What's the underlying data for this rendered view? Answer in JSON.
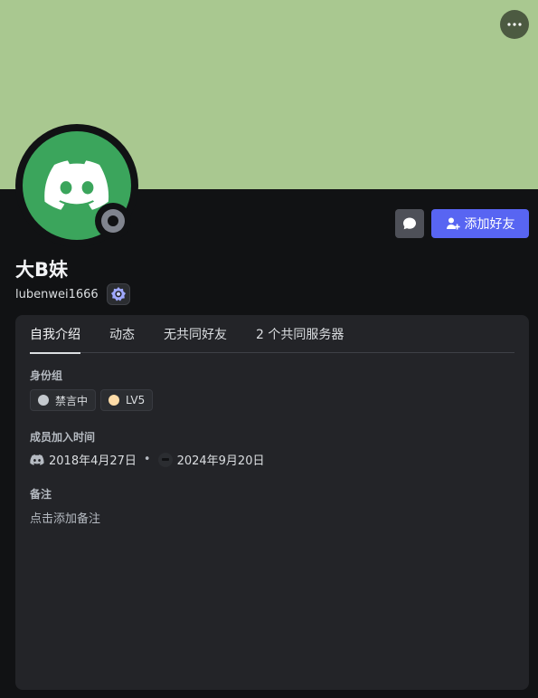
{
  "colors": {
    "banner": "#a9c890",
    "avatar_bg": "#3ba55c",
    "primary": "#5865f2",
    "role_muted": "#c4c9ce",
    "role_lv5": "#ffdca8"
  },
  "header": {
    "more_icon": "ellipsis-icon"
  },
  "profile": {
    "display_name": "大B妹",
    "username": "lubenwei1666",
    "status": "offline",
    "badge_icon": "nitro-badge-icon"
  },
  "actions": {
    "message_icon": "chat-bubble-icon",
    "add_friend_label": "添加好友"
  },
  "tabs": [
    {
      "label": "自我介绍",
      "active": true
    },
    {
      "label": "动态",
      "active": false
    },
    {
      "label": "无共同好友",
      "active": false
    },
    {
      "label": "2 个共同服务器",
      "active": false
    }
  ],
  "roles": {
    "title": "身份组",
    "items": [
      {
        "label": "禁言中"
      },
      {
        "label": "LV5"
      }
    ]
  },
  "member_since": {
    "title": "成员加入时间",
    "discord_date": "2018年4月27日",
    "separator": "•",
    "server_date": "2024年9月20日"
  },
  "note": {
    "title": "备注",
    "placeholder": "点击添加备注"
  }
}
